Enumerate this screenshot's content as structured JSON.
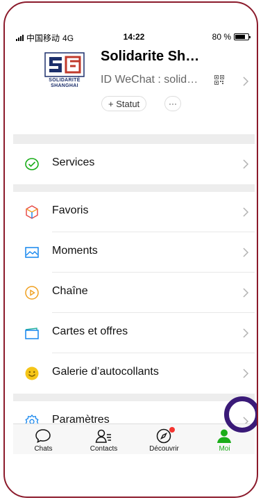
{
  "status_bar": {
    "carrier": "中国移动",
    "network": "4G",
    "time": "14:22",
    "battery_text": "80 %",
    "battery_level": 0.8
  },
  "profile": {
    "logo_text_line1": "SOLIDARITÉ",
    "logo_text_line2": "SHANGHAI",
    "name": "Solidarite Sh…",
    "wechat_id": "ID WeChat : solid…",
    "statut_label": "+ Statut",
    "more_label": "···"
  },
  "menu": {
    "services": "Services",
    "favoris": "Favoris",
    "moments": "Moments",
    "chaine": "Chaîne",
    "cartes": "Cartes et offres",
    "galerie": "Galerie d’autocollants",
    "parametres": "Paramètres"
  },
  "tabs": {
    "chats": "Chats",
    "contacts": "Contacts",
    "decouvrir": "Découvrir",
    "moi": "Moi"
  },
  "colors": {
    "accent_green": "#1aad19",
    "highlight": "#3a1a78",
    "frame": "#8b1a2b",
    "badge": "#f43530"
  }
}
